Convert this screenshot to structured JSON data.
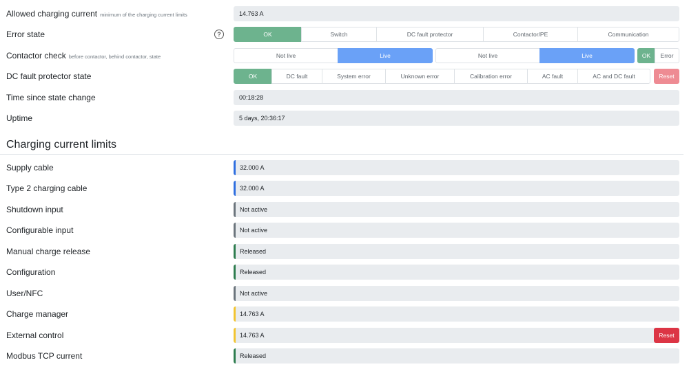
{
  "status": {
    "allowed_current": {
      "label": "Allowed charging current",
      "hint": "minimum of the charging current limits",
      "value": "14.763 A"
    },
    "error_state": {
      "label": "Error state",
      "help_glyph": "?",
      "options": [
        "OK",
        "Switch",
        "DC fault protector",
        "Contactor/PE",
        "Communication"
      ]
    },
    "contactor_check": {
      "label": "Contactor check",
      "hint": "before contactor, behind contactor, state",
      "before": [
        "Not live",
        "Live"
      ],
      "behind": [
        "Not live",
        "Live"
      ],
      "state": [
        "OK",
        "Error"
      ]
    },
    "dc_fault": {
      "label": "DC fault protector state",
      "options": [
        "OK",
        "DC fault",
        "System error",
        "Unknown error",
        "Calibration error",
        "AC fault",
        "AC and DC fault"
      ],
      "reset_label": "Reset"
    },
    "time_since_change": {
      "label": "Time since state change",
      "value": "00:18:28"
    },
    "uptime": {
      "label": "Uptime",
      "value": "5 days, 20:36:17"
    }
  },
  "limits": {
    "title": "Charging current limits",
    "reset_label": "Reset",
    "items": [
      {
        "label": "Supply cable",
        "value": "32.000 A",
        "color": "#2f6fe0"
      },
      {
        "label": "Type 2 charging cable",
        "value": "32.000 A",
        "color": "#2f6fe0"
      },
      {
        "label": "Shutdown input",
        "value": "Not active",
        "color": "#6c757d"
      },
      {
        "label": "Configurable input",
        "value": "Not active",
        "color": "#6c757d"
      },
      {
        "label": "Manual charge release",
        "value": "Released",
        "color": "#2e7d4f"
      },
      {
        "label": "Configuration",
        "value": "Released",
        "color": "#2e7d4f"
      },
      {
        "label": "User/NFC",
        "value": "Not active",
        "color": "#6c757d"
      },
      {
        "label": "Charge manager",
        "value": "14.763 A",
        "color": "#f2c431"
      },
      {
        "label": "External control",
        "value": "14.763 A",
        "color": "#f2c431"
      },
      {
        "label": "Modbus TCP current",
        "value": "Released",
        "color": "#2e7d4f"
      }
    ]
  }
}
